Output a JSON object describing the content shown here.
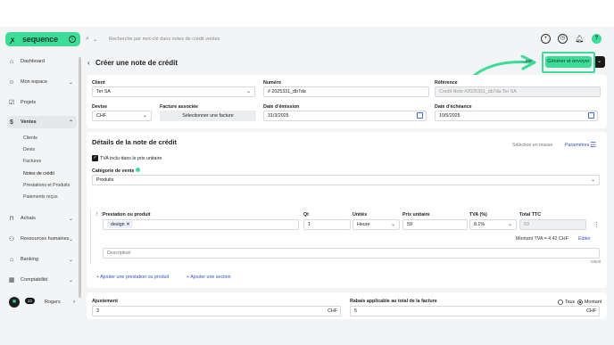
{
  "app": {
    "brand": "sequence",
    "accent_color": "#3ddc97",
    "search_placeholder": "Recherche par mot-clé dans notes de crédit ventes"
  },
  "top_icons": [
    "plus-circle-icon",
    "clock-icon",
    "bell-icon",
    "help-icon"
  ],
  "sidebar": {
    "items": [
      {
        "label": "Dashboard",
        "icon": "home-icon"
      },
      {
        "label": "Mon espace",
        "icon": "user-icon"
      },
      {
        "label": "Projets",
        "icon": "check-square-icon"
      },
      {
        "label": "Ventes",
        "icon": "money-bag-icon"
      },
      {
        "label": "Achats",
        "icon": "shopping-bag-icon"
      },
      {
        "label": "Ressources humaines",
        "icon": "people-icon"
      },
      {
        "label": "Banking",
        "icon": "bank-icon"
      },
      {
        "label": "Comptabilité",
        "icon": "calculator-icon"
      }
    ],
    "ventes_sub": [
      "Clients",
      "Devis",
      "Factures",
      "Notes de crédit",
      "Prestations et Produits",
      "Paiements reçus"
    ],
    "user": {
      "name": "Rogers",
      "badge": "22"
    }
  },
  "page": {
    "title": "Créer une note de crédit",
    "secondary_btn": "...ser",
    "primary_btn": "Générer et envoyer"
  },
  "form": {
    "client_label": "Client",
    "client_value": "Ter SA",
    "numero_label": "Numéro",
    "numero_value": "# 2025331_db7da",
    "reference_label": "Référence",
    "reference_value": "Credit Note #2025331_db7da Ter SA",
    "devise_label": "Devise",
    "devise_value": "CHF",
    "facture_label": "Facture associée",
    "facture_btn": "Sélectionner une facture",
    "emission_label": "Date d'émission",
    "emission_value": "31/3/2025",
    "echeance_label": "Date d'échéance",
    "echeance_value": "10/5/2025"
  },
  "details": {
    "title": "Détails de la note de crédit",
    "selection_mode": "Sélection en masse",
    "params": "Paramètres",
    "tva_checkbox": "TVA inclu dans le prix unitaire",
    "categorie_label": "Catégorie de vente",
    "categorie_value": "Produits",
    "columns": [
      "Prestation ou produit",
      "Qt",
      "Unités",
      "Prix unitaire",
      "TVA (%)",
      "Total TTC"
    ],
    "row": {
      "product": "design",
      "qty": "1",
      "unit": "Heure",
      "price": "59",
      "tva": "8.1%",
      "total": "59"
    },
    "montant_tva": "Montant TVA = 4.42 CHF",
    "edit": "Editer",
    "description_placeholder": "Description",
    "char_count": "0/500",
    "add_product": "Ajouter une prestation ou produit",
    "add_section": "Ajouter une section"
  },
  "adjust": {
    "ajustement_label": "Ajustement",
    "ajustement_value": "3",
    "ajustement_unit": "CHF",
    "rabais_label": "Rabais applicable au total de la facture",
    "taux": "Taux",
    "montant": "Montant",
    "rabais_value": "5",
    "rabais_unit": "CHF"
  }
}
